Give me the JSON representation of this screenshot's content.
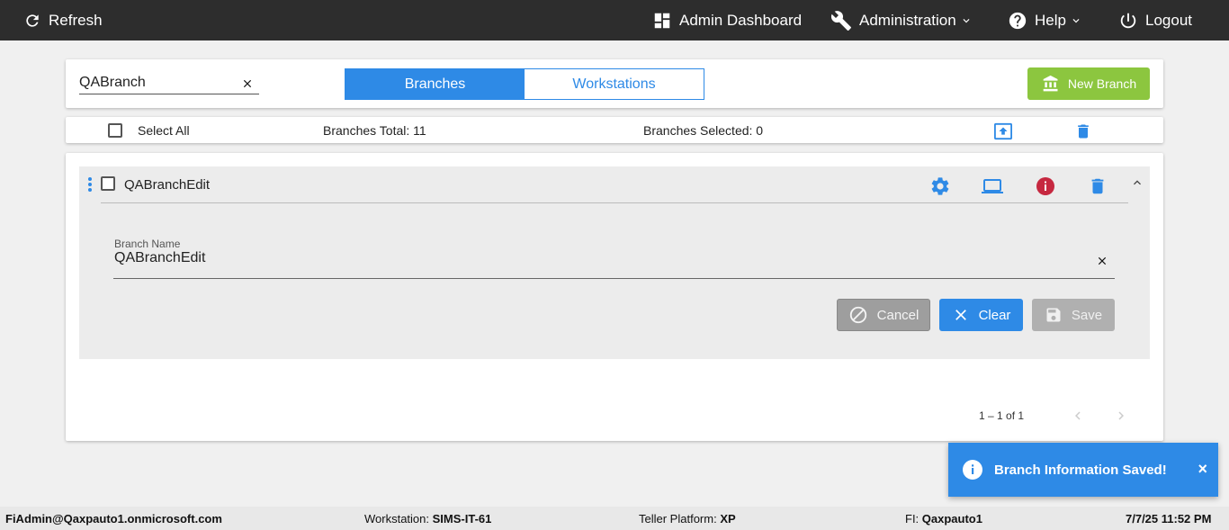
{
  "topbar": {
    "refresh_label": "Refresh",
    "admin_dashboard_label": "Admin Dashboard",
    "administration_label": "Administration",
    "help_label": "Help",
    "logout_label": "Logout",
    "bg_color": "#2d2d2d"
  },
  "search": {
    "value": "QABranch"
  },
  "tabs": [
    {
      "label": "Branches",
      "active": true
    },
    {
      "label": "Workstations",
      "active": false
    }
  ],
  "new_branch_label": "New Branch",
  "summary": {
    "select_all_label": "Select All",
    "total_label": "Branches Total: 11",
    "selected_label": "Branches Selected: 0"
  },
  "branch_row": {
    "name": "QABranchEdit",
    "field_label": "Branch Name",
    "field_value": "QABranchEdit",
    "cancel_label": "Cancel",
    "clear_label": "Clear",
    "save_label": "Save"
  },
  "pagination": {
    "range_label": "1 – 1 of 1"
  },
  "toast": {
    "message": "Branch Information Saved!",
    "close": "×"
  },
  "footer": {
    "user": "FiAdmin@Qaxpauto1.onmicrosoft.com",
    "workstation_label": "Workstation:",
    "workstation_value": "SIMS-IT-61",
    "platform_label": "Teller Platform:",
    "platform_value": "XP",
    "fi_label": "FI:",
    "fi_value": "Qaxpauto1",
    "datetime": "7/7/25 11:52 PM"
  },
  "colors": {
    "accent": "#2e8ae6",
    "success": "#8cc63f",
    "danger": "#c62840"
  }
}
